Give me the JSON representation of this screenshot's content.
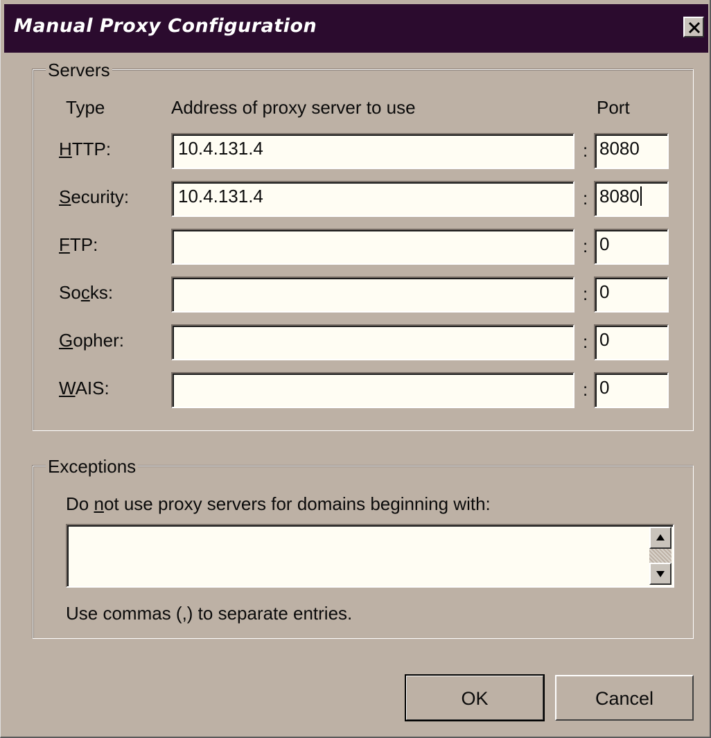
{
  "window": {
    "title": "Manual Proxy Configuration"
  },
  "servers": {
    "group_label": "Servers",
    "col_type": "Type",
    "col_address": "Address of proxy server to use",
    "col_port": "Port",
    "rows": [
      {
        "label_pre": "",
        "label_u": "H",
        "label_post": "TTP:",
        "address": "10.4.131.4",
        "port": "8080"
      },
      {
        "label_pre": "",
        "label_u": "S",
        "label_post": "ecurity:",
        "address": "10.4.131.4",
        "port": "8080"
      },
      {
        "label_pre": "",
        "label_u": "F",
        "label_post": "TP:",
        "address": "",
        "port": "0"
      },
      {
        "label_pre": "So",
        "label_u": "c",
        "label_post": "ks:",
        "address": "",
        "port": "0"
      },
      {
        "label_pre": "",
        "label_u": "G",
        "label_post": "opher:",
        "address": "",
        "port": "0"
      },
      {
        "label_pre": "",
        "label_u": "W",
        "label_post": "AIS:",
        "address": "",
        "port": "0"
      }
    ],
    "separator": ":"
  },
  "exceptions": {
    "group_label": "Exceptions",
    "desc_pre": "Do ",
    "desc_u": "n",
    "desc_post": "ot use proxy servers for domains beginning with:",
    "value": "",
    "hint": "Use commas (,) to separate entries."
  },
  "buttons": {
    "ok": "OK",
    "cancel": "Cancel"
  },
  "icons": {
    "close": "close-icon",
    "scroll_up": "scroll-up-arrow-icon",
    "scroll_down": "scroll-down-arrow-icon"
  },
  "colors": {
    "face": "#bdb1a5",
    "titlebar": "#2b0b2e",
    "field": "#fffdf3"
  }
}
